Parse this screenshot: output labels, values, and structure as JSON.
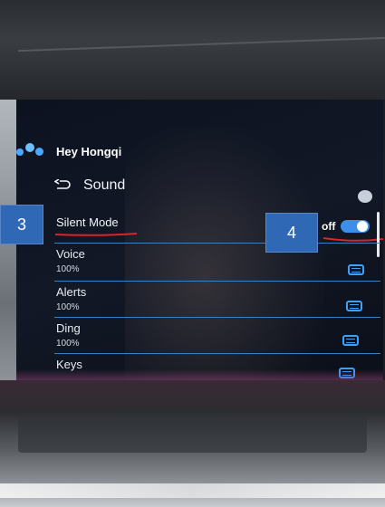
{
  "assistant": {
    "name": "Hey Hongqi"
  },
  "header": {
    "title": "Sound"
  },
  "silent_mode": {
    "label": "Silent Mode",
    "toggle_text": "off"
  },
  "settings": [
    {
      "label": "Voice",
      "value": "100%"
    },
    {
      "label": "Alerts",
      "value": "100%"
    },
    {
      "label": "Ding",
      "value": "100%"
    },
    {
      "label": "Keys",
      "value": ""
    }
  ],
  "annotations": {
    "marker_left": "3",
    "marker_right": "4"
  },
  "colors": {
    "accent": "#3d8ee8",
    "annotation_red": "#d8242a",
    "marker_bg": "#2f68b5"
  }
}
